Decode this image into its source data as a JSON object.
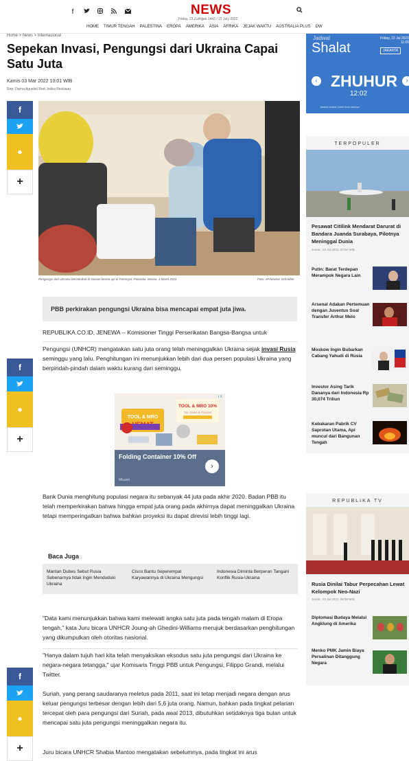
{
  "header": {
    "social_icons": [
      "facebook-icon",
      "twitter-icon",
      "instagram-icon",
      "rss-icon",
      "email-icon"
    ],
    "logo": "NEWS",
    "date_line": "Friday, 23 Zulhijjah 1443 / 22 July 2022",
    "nav": [
      "HOME",
      "TIMUR TENGAH",
      "PALESTINA",
      "EROPA",
      "AMERIKA",
      "ASIA",
      "AFRIKA",
      "JEJAK WAKTU",
      "AUSTRALIA PLUS",
      "DW"
    ]
  },
  "article": {
    "breadcrumb": "Home > News > Internasional",
    "title": "Sepekan Invasi, Pengungsi dari Ukraina Capai Satu Juta",
    "date": "Kamis 03 Mar 2022 10:01 WIB",
    "reporter": "Rep: Dwina Agustin/ Red: Indira Rezkisari",
    "caption": "Pengungsi dari Ukraina beristirahat di stasiun kereta api di Przemysl, Polandia, Selasa, 1 Maret 2022.",
    "photo_credit": "Foto: AP/Markus Schreiber",
    "summary": "PBB perkirakan pengungsi Ukraina bisa mencapai empat juta jiwa.",
    "p1": "REPUBLIKA.CO.ID, JENEWA -- Komisioner Tinggi Perserikatan Bangsa-Bangsa untuk",
    "p2_a": "Pengungsi (UNHCR) mengatakan satu juta orang telah meninggalkan Ukraina sejak ",
    "p2_link": "invasi Rusia ",
    "p2_b": "seminggu yang lalu. Penghitungan ini menunjukkan lebih dari dua persen populasi Ukraina yang berpindah-pindah dalam waktu kurang dari seminggu.",
    "p3": "Bank Dunia menghitung populasi negara itu sebanyak 44 juta pada akhir 2020. Badan PBB itu telah memperkirakan bahwa hingga empat juta orang pada akhirnya dapat meninggalkan Ukraina tetapi memperingatkan bahwa bahkan proyeksi itu dapat direvisi lebih tinggi lagi.",
    "baca_juga_label": "Baca Juga",
    "baca_juga": [
      "Mantan Dubes Sebut Rusia Sebenarnya tidak Ingin Menduduki Ukraina",
      "Cisco Bantu Seperempat Karyawannya di Ukraina Mengungsi",
      "Indonesia Diminta Berperan Tangani Konflik Rusia-Ukraina"
    ],
    "p4": "\"Data kami menunjukkan bahwa kami melewati angka satu juta pada tengah malam di Eropa tengah,\" kata Juru bicara UNHCR Joung-ah Ghedini-Williams merujuk berdasarkan penghitungan yang dikumpulkan oleh otoritas nasional.",
    "p5": "\"Hanya dalam tujuh hari kita telah menyaksikan eksodus satu juta pengungsi dari Ukraina ke negara-negara tetangga,\" ujar Komisaris Tinggi PBB untuk Pengungsi, Filippo Grandi, melalui Twitter.",
    "p6": "Suriah, yang perang saudaranya meletus pada 2011, saat ini tetap menjadi negara dengan arus keluar pengungsi terbesar dengan lebih dari 5,6 juta orang. Namun, bahkan pada tingkat pelarian tercepat oleh para pengungsi dari Suriah, pada awal 2013, dibutuhkan setidaknya tiga bulan untuk mencapai satu juta pengungsi meninggalkan negara itu.",
    "p7": "Juru bicara UNHCR Shabia Mantoo mengatakan sebelumnya, pada tingkat ini arus"
  },
  "ad": {
    "badge": "i X",
    "headline": "TOOL & MRO HEMAT",
    "offer": "TOOL & MRO 10%",
    "title": "Folding Container 10% Off",
    "brand": "Misumi"
  },
  "shalat": {
    "label": "Jadwal",
    "title": "Shalat",
    "date": "Friday, 22 Jul 2022 11:05",
    "city": "JAKARTA",
    "prayer": "ZHUHUR",
    "time": "12:02",
    "footer": "Jadwal shalat untuk kota lainnya"
  },
  "terpopuler": {
    "heading": "TERPOPULER",
    "featured_title": "Pesawat Citilink Mendarat Darurat di Bandara Juanda Surabaya, Pilotnya Meninggal Dunia",
    "featured_date": "Jumat , 22 Jul 2022, 00:00 WIB",
    "items": [
      "Putin: Barat Terdepan Merampok Negara Lain",
      "Arsenal Adakan Pertemuan dengan Juventus Soal Transfer Arthur Melo",
      "Moskow Ingin Bubarkan Cabang Yahudi di Rusia",
      "Investor Asing Tarik Dananya dari Indonesia Rp 30,074 Triliun",
      "Kebakaran Pabrik CV Saprotan Utama, Api muncul dari Bangunan Tengah"
    ]
  },
  "republikatv": {
    "heading": "REPUBLIKA TV",
    "featured_title": "Rusia Dinilai Tabur Perpecahan Lewat Kelompok Neo-Nazi",
    "featured_date": "Jumat , 22 Jul 2022, 08:38 WIB",
    "items": [
      "Diplomasi Budaya Melalui Angklung di Amerika",
      "Menko PMK Jamin Biaya Persalinan Ditanggung Negara"
    ]
  },
  "share": {
    "fb": "f",
    "tw": "t",
    "plus": "+"
  },
  "colors": {
    "brand": "#d10000",
    "facebook": "#3b5998",
    "twitter": "#1da1f2",
    "comment": "#f0c020",
    "shalat": "#3a78c9"
  }
}
